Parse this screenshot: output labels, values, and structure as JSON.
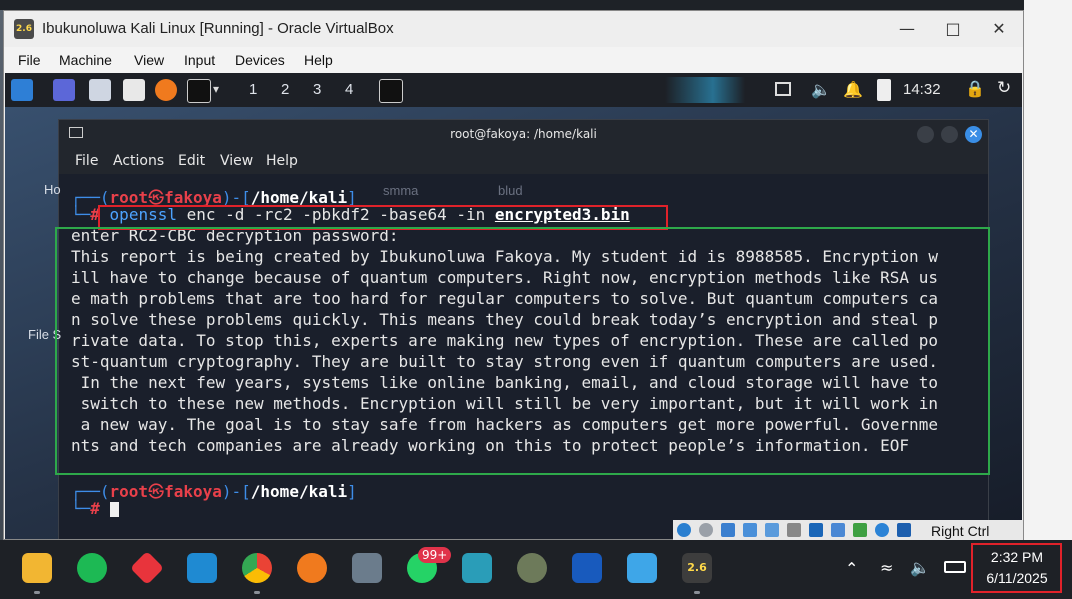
{
  "host": {
    "partial_labels": [
      "Ho",
      "File S"
    ]
  },
  "vbox": {
    "title": "Ibukunoluwa Kali Linux [Running] - Oracle VirtualBox",
    "app_icon_text": "2.6",
    "menu": [
      "File",
      "Machine",
      "View",
      "Input",
      "Devices",
      "Help"
    ],
    "status_right_ctrl": "Right Ctrl"
  },
  "kali_panel": {
    "workspaces": [
      "1",
      "2",
      "3",
      "4"
    ],
    "clock": "14:32"
  },
  "desktop_hints": [
    "smma",
    "blud"
  ],
  "terminal": {
    "title": "root@fakoya: /home/kali",
    "menu": [
      "File",
      "Actions",
      "Edit",
      "View",
      "Help"
    ],
    "prompt": {
      "user": "root",
      "symbol": "㉿",
      "host": "fakoya",
      "path": "/home/kali",
      "hash": "#"
    },
    "command": {
      "cmd": "openssl",
      "args": "enc -d -rc2 -pbkdf2 -base64 -in",
      "file": "encrypted3.bin"
    },
    "output": [
      "enter RC2-CBC decryption password:",
      "This report is being created by Ibukunoluwa Fakoya. My student id is 8988585. Encryption w",
      "ill have to change because of quantum computers. Right now, encryption methods like RSA us",
      "e math problems that are too hard for regular computers to solve. But quantum computers ca",
      "n solve these problems quickly. This means they could break today’s encryption and steal p",
      "rivate data. To stop this, experts are making new types of encryption. These are called po",
      "st-quantum cryptography. They are built to stay strong even if quantum computers are used.",
      " In the next few years, systems like online banking, email, and cloud storage will have to",
      " switch to these new methods. Encryption will still be very important, but it will work in",
      " a new way. The goal is to stay safe from hackers as computers get more powerful. Governme",
      "nts and tech companies are already working on this to protect people’s information. EOF"
    ]
  },
  "taskbar": {
    "whatsapp_badge": "99+",
    "vbox_badge": "2.6",
    "time": "2:32 PM",
    "date": "6/11/2025"
  },
  "colors": {
    "prompt_red": "#e8404a",
    "prompt_blue": "#3e8de8",
    "path_white": "#ffffff",
    "command_blue": "#4da3ff",
    "annotation_red": "#e0222a",
    "annotation_green": "#2ea84a"
  }
}
